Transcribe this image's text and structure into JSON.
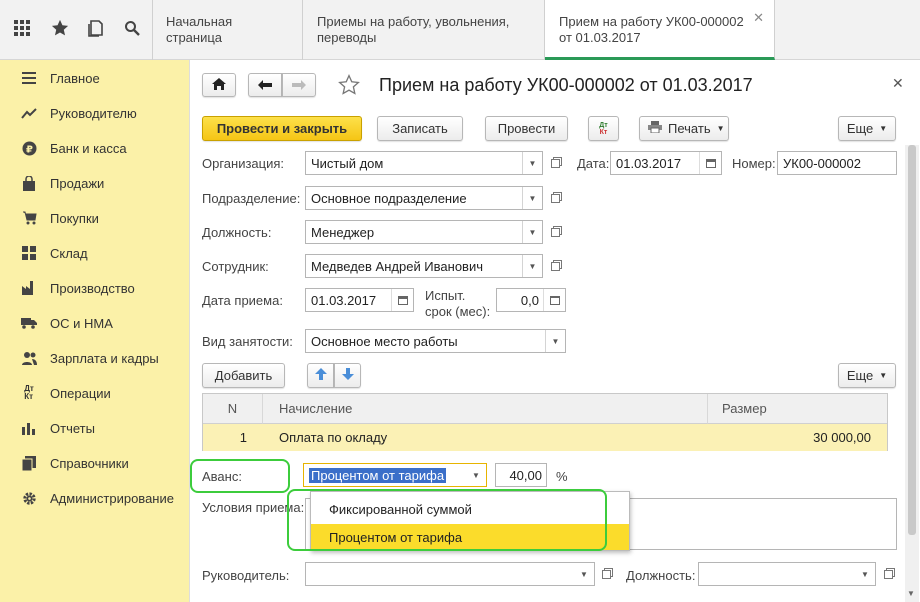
{
  "tabs": [
    {
      "label": "Начальная страница"
    },
    {
      "label": "Приемы на работу, увольнения, переводы"
    },
    {
      "label": "Прием на работу УК00-000002 от 01.03.2017",
      "active": true
    }
  ],
  "topbar_icons": [
    "apps-grid-icon",
    "star-icon",
    "history-icon",
    "search-icon"
  ],
  "sidebar": {
    "items": [
      {
        "label": "Главное",
        "icon": "menu-icon"
      },
      {
        "label": "Руководителю",
        "icon": "trend-icon"
      },
      {
        "label": "Банк и касса",
        "icon": "ruble-icon"
      },
      {
        "label": "Продажи",
        "icon": "bag-icon"
      },
      {
        "label": "Покупки",
        "icon": "cart-icon"
      },
      {
        "label": "Склад",
        "icon": "warehouse-icon"
      },
      {
        "label": "Производство",
        "icon": "factory-icon"
      },
      {
        "label": "ОС и НМА",
        "icon": "truck-icon"
      },
      {
        "label": "Зарплата и кадры",
        "icon": "people-icon"
      },
      {
        "label": "Операции",
        "icon": "dt-kt-icon"
      },
      {
        "label": "Отчеты",
        "icon": "chart-icon"
      },
      {
        "label": "Справочники",
        "icon": "book-icon"
      },
      {
        "label": "Администрирование",
        "icon": "gear-icon"
      }
    ]
  },
  "header": {
    "title": "Прием на работу УК00-000002 от 01.03.2017"
  },
  "toolbar": {
    "post_close": "Провести и закрыть",
    "save": "Записать",
    "post": "Провести",
    "dtkt": "Дт Кт",
    "print": "Печать",
    "more": "Еще"
  },
  "fields": {
    "org_label": "Организация:",
    "org_value": "Чистый дом",
    "date_label": "Дата:",
    "date_value": "01.03.2017",
    "number_label": "Номер:",
    "number_value": "УК00-000002",
    "dept_label": "Подразделение:",
    "dept_value": "Основное подразделение",
    "position_label": "Должность:",
    "position_value": "Менеджер",
    "employee_label": "Сотрудник:",
    "employee_value": "Медведев Андрей Иванович",
    "hire_date_label": "Дата приема:",
    "hire_date_value": "01.03.2017",
    "probation_label_1": "Испыт.",
    "probation_label_2": "срок (мес):",
    "probation_value": "0,0",
    "employment_label": "Вид занятости:",
    "employment_value": "Основное место работы"
  },
  "accruals": {
    "add": "Добавить",
    "more": "Еще",
    "columns": [
      "N",
      "Начисление",
      "Размер"
    ],
    "rows": [
      {
        "n": "1",
        "name": "Оплата по окладу",
        "amount": "30 000,00"
      }
    ]
  },
  "advance": {
    "label": "Аванс:",
    "selected": "Процентом от тарифа",
    "value": "40,00",
    "unit": "%",
    "options": [
      "Фиксированной суммой",
      "Процентом от тарифа"
    ]
  },
  "conditions_label": "Условия приема:",
  "manager_label": "Руководитель:",
  "manager_position_label": "Должность:",
  "colors": {
    "accent_yellow": "#f5c515",
    "highlight_green": "#3ccc3c",
    "sidebar_bg": "#fbf1a8",
    "selection_blue": "#3b6fc9"
  }
}
